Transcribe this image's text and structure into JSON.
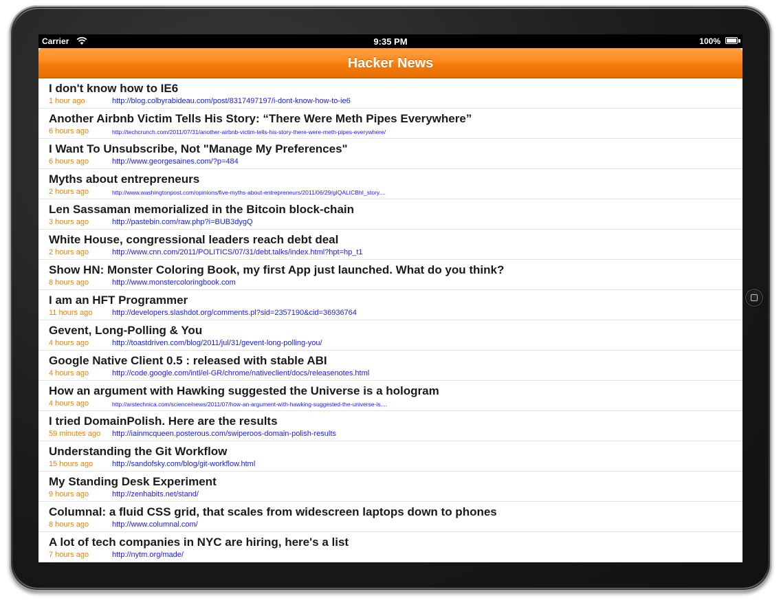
{
  "status_bar": {
    "carrier": "Carrier",
    "time": "9:35 PM",
    "battery": "100%"
  },
  "nav": {
    "title": "Hacker News"
  },
  "colors": {
    "nav_orange": "#f47b0c",
    "time_orange": "#f08000",
    "link_blue": "#1a1aee"
  },
  "stories": [
    {
      "title": "I don't know how  to IE6",
      "time": "1 hour ago",
      "url": "http://blog.colbyrabideau.com/post/8317497197/i-dont-know-how-to-ie6"
    },
    {
      "title": "Another Airbnb Victim Tells His Story: “There Were Meth Pipes Everywhere”",
      "time": "6 hours ago",
      "url": "http://techcrunch.com/2011/07/31/another-airbnb-victim-tells-his-story-there-were-meth-pipes-everywhere/"
    },
    {
      "title": "I Want To Unsubscribe, Not \"Manage My Preferences\"",
      "time": "6 hours ago",
      "url": "http://www.georgesaines.com/?p=484"
    },
    {
      "title": "Myths about entrepreneurs",
      "time": "2 hours ago",
      "url": "http://www.washingtonpost.com/opinions/five-myths-about-entrepreneurs/2011/06/29/gIQALtCBhI_story...."
    },
    {
      "title": "Len Sassaman memorialized in the Bitcoin block-chain",
      "time": "3 hours ago",
      "url": "http://pastebin.com/raw.php?i=BUB3dygQ"
    },
    {
      "title": "White House, congressional leaders reach debt deal",
      "time": "2 hours ago",
      "url": "http://www.cnn.com/2011/POLITICS/07/31/debt.talks/index.html?hpt=hp_t1"
    },
    {
      "title": "Show HN: Monster Coloring Book, my first App just launched. What do you think?",
      "time": "8 hours ago",
      "url": "http://www.monstercoloringbook.com"
    },
    {
      "title": "I am an HFT Programmer",
      "time": "11 hours ago",
      "url": "http://developers.slashdot.org/comments.pl?sid=2357190&cid=36936764"
    },
    {
      "title": "Gevent, Long-Polling & You",
      "time": "4 hours ago",
      "url": "http://toastdriven.com/blog/2011/jul/31/gevent-long-polling-you/"
    },
    {
      "title": "Google Native Client 0.5 : released with stable ABI",
      "time": "4 hours ago",
      "url": "http://code.google.com/intl/el-GR/chrome/nativeclient/docs/releasenotes.html"
    },
    {
      "title": "How an argument with Hawking suggested the Universe is a hologram",
      "time": "4 hours ago",
      "url": "http://arstechnica.com/science/news/2011/07/how-an-argument-with-hawking-suggested-the-universe-is...."
    },
    {
      "title": "I tried DomainPolish. Here are the results",
      "time": "59 minutes ago",
      "url": "http://iainmcqueen.posterous.com/swiperoos-domain-polish-results"
    },
    {
      "title": "Understanding the Git Workflow",
      "time": "15 hours ago",
      "url": "http://sandofsky.com/blog/git-workflow.html"
    },
    {
      "title": "My Standing Desk Experiment",
      "time": "9 hours ago",
      "url": "http://zenhabits.net/stand/"
    },
    {
      "title": "Columnal: a fluid CSS grid, that scales from widescreen laptops down to phones",
      "time": "8 hours ago",
      "url": "http://www.columnal.com/"
    },
    {
      "title": "A lot of tech companies in NYC are hiring, here's a list",
      "time": "7 hours ago",
      "url": "http://nytm.org/made/"
    }
  ]
}
